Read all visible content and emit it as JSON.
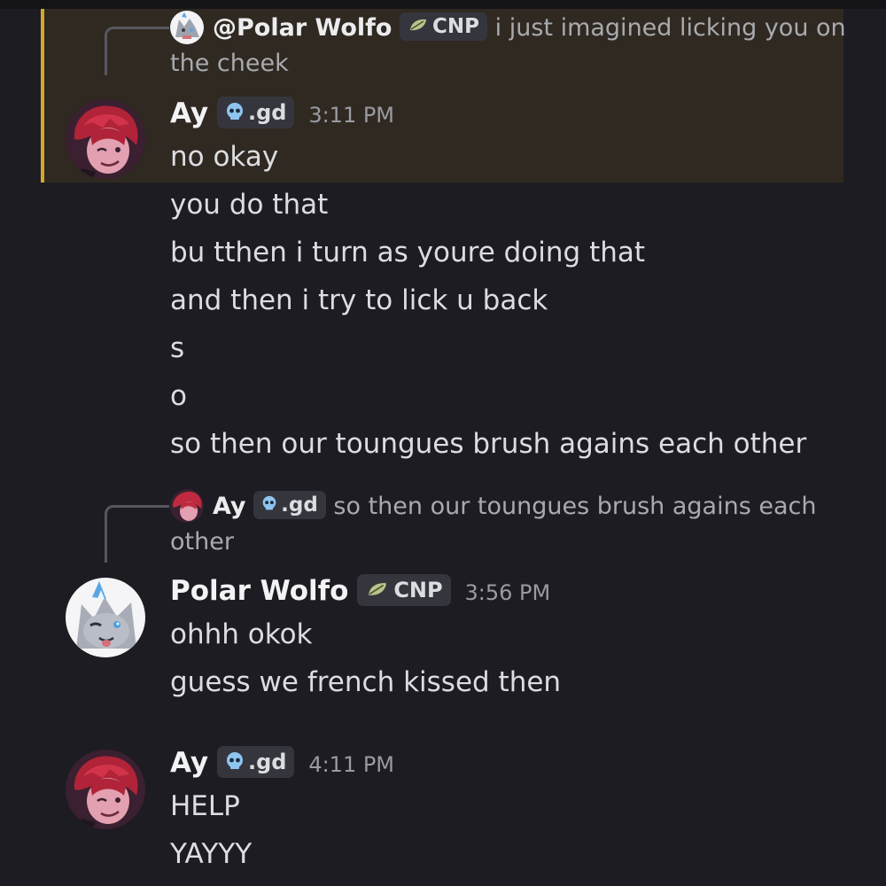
{
  "messages": {
    "reply1": {
      "author": "@Polar Wolfo",
      "tag": "CNP",
      "snippet_line1": "i just imagined licking you on",
      "snippet_line2": "the cheek"
    },
    "group1": {
      "author": "Ay",
      "tag": ".gd",
      "time": "3:11 PM",
      "lines": [
        "no okay",
        "you do that",
        "bu tthen i turn as youre doing that",
        "and then i try to lick u back",
        "s",
        "o",
        "so then our toungues brush agains each other"
      ]
    },
    "reply2": {
      "author": "Ay",
      "tag": ".gd",
      "snippet_line1": "so then our toungues brush agains each",
      "snippet_line2": "other"
    },
    "group2": {
      "author": "Polar Wolfo",
      "tag": "CNP",
      "time": "3:56 PM",
      "lines": [
        "ohhh okok",
        "guess we french kissed then"
      ]
    },
    "group3": {
      "author": "Ay",
      "tag": ".gd",
      "time": "4:11 PM",
      "lines": [
        "HELP",
        "YAYYY"
      ]
    }
  },
  "colors": {
    "background": "#1c1c22",
    "highlight_background": "#2f2921",
    "highlight_bar": "#d4a82c",
    "skull_badge": "#8ec5f0",
    "leaf_badge": "#b8c48a"
  },
  "icons": {
    "gd_tag": "skull-icon",
    "cnp_tag": "leaf-icon"
  }
}
